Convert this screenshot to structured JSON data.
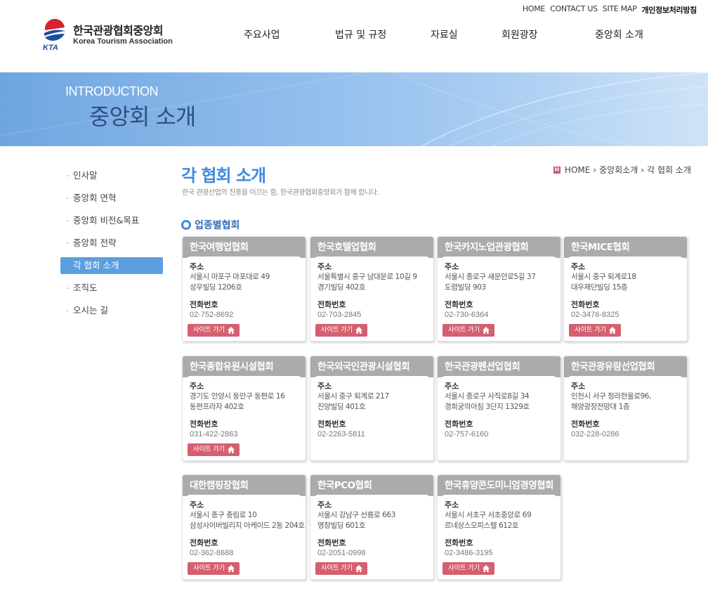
{
  "util_links": [
    "HOME",
    "CONTACT US",
    "SITE MAP",
    "개인정보처리방침"
  ],
  "logo": {
    "ko": "한국관광협회중앙회",
    "en": "Korea Tourism Association",
    "mark": "KTA"
  },
  "gnb": [
    "주요사업",
    "법규 및 규정",
    "자료실",
    "회원광장",
    "중앙회 소개"
  ],
  "banner": {
    "en": "INTRODUCTION",
    "ko": "중앙회 소개"
  },
  "lnb": [
    {
      "label": "인사말",
      "active": false
    },
    {
      "label": "중앙회 연혁",
      "active": false
    },
    {
      "label": "중앙회 비전&목표",
      "active": false
    },
    {
      "label": "중앙회 전략",
      "active": false
    },
    {
      "label": "각 협회 소개",
      "active": true
    },
    {
      "label": "조직도",
      "active": false
    },
    {
      "label": "오시는 길",
      "active": false
    }
  ],
  "page": {
    "title": "각 협회 소개",
    "desc": "한국 관광산업의 진흥을 이끄는 힘, 한국관광협회중앙회가 함께 합니다.",
    "breadcrumb": [
      "HOME",
      "중앙회소개",
      "각 협회 소개"
    ],
    "section": "업종별협회"
  },
  "labels": {
    "addr": "주소",
    "tel": "전화번호",
    "site": "사이트 가기"
  },
  "cards": [
    {
      "name": "한국여행업협회",
      "addr1": "서울시 마포구 마포대로 49",
      "addr2": "성우빌딩 1206호",
      "tel": "02-752-8692",
      "site": true
    },
    {
      "name": "한국호텔업협회",
      "addr1": "서울특별시 중구 남대문로 10길 9",
      "addr2": "경기빌딩 402호",
      "tel": "02-703-2845",
      "site": true
    },
    {
      "name": "한국카지노업관광협회",
      "addr1": "서울시 종로구 새문안로5길 37",
      "addr2": "도렴빌딩 903",
      "tel": "02-730-6364",
      "site": true
    },
    {
      "name": "한국MICE협회",
      "addr1": "서울시 중구 퇴계로18",
      "addr2": "대우재단빌딩 15층",
      "tel": "02-3476-8325",
      "site": true
    },
    {
      "name": "한국종합유원시설협회",
      "addr1": "경기도 안양시 동안구 동편로 16",
      "addr2": "동편프라자 402호",
      "tel": "031-422-2863",
      "site": true
    },
    {
      "name": "한국외국인관광시설협회",
      "addr1": "서울시 중구 퇴계로 217",
      "addr2": "진양빌딩 401호",
      "tel": "02-2263-5811",
      "site": false
    },
    {
      "name": "한국관광펜션업협회",
      "addr1": "서울시 종로구 사직로8길 34",
      "addr2": "경희궁의아침 3단지 1329호",
      "tel": "02-757-6160",
      "site": false
    },
    {
      "name": "한국관광유람선업협회",
      "addr1": "인천시 서구 청라한울로96,",
      "addr2": "해양광장전망대 1층",
      "tel": "032-228-0286",
      "site": false
    },
    {
      "name": "대한캠핑장협회",
      "addr1": "서울시 종구 충림로 10",
      "addr2": "삼성사이버빌리지 아케이드 2동 204호",
      "tel": "02-362-8688",
      "site": true
    },
    {
      "name": "한국PCO협회",
      "addr1": "서울시 강남구 선릉로 663",
      "addr2": "영창빌딩 601호",
      "tel": "02-2051-0998",
      "site": true
    },
    {
      "name": "한국휴양콘도미니엄경영협회",
      "addr1": "서울시 서초구 서초중앙로 69",
      "addr2": "르네상스오피스텔 612호",
      "tel": "02-3486-3195",
      "site": true
    }
  ]
}
